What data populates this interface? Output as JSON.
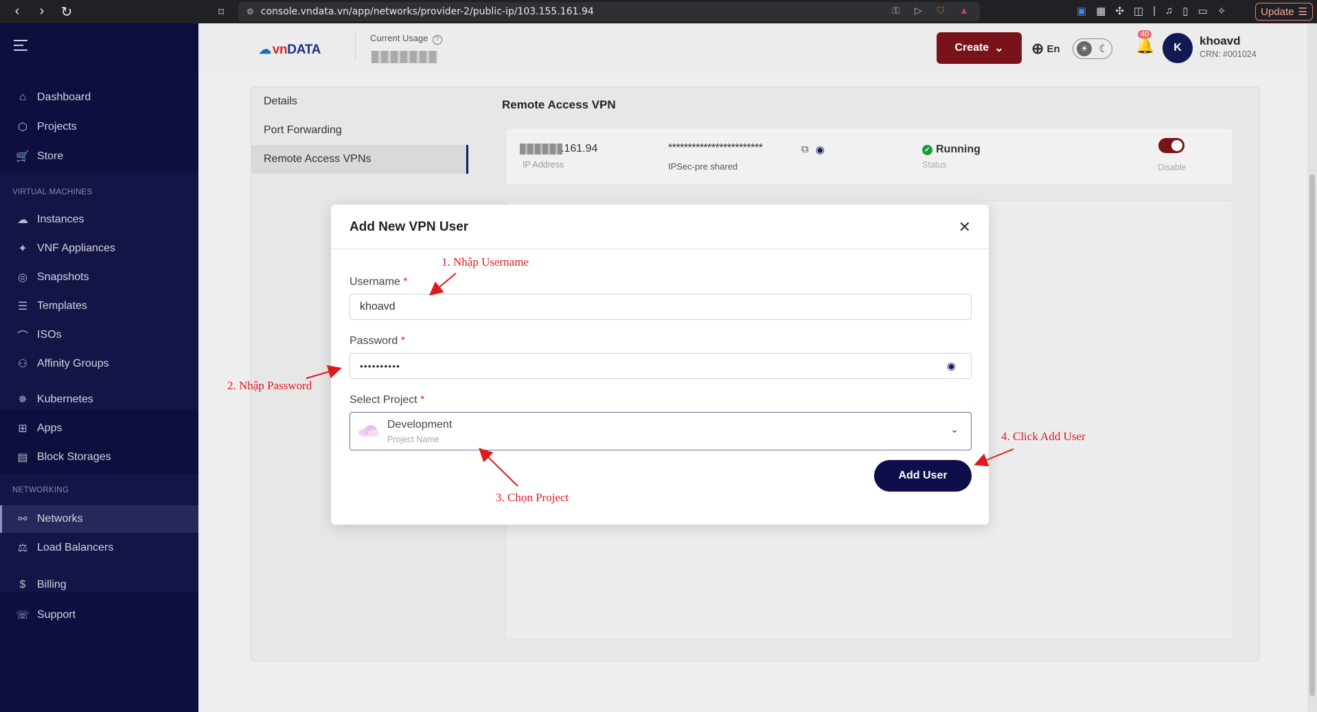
{
  "browser": {
    "url": "console.vndata.vn/app/networks/provider-2/public-ip/103.155.161.94",
    "update_label": "Update",
    "icons": [
      "back-icon",
      "forward-icon",
      "reload-icon",
      "bookmark-icon"
    ]
  },
  "sidebar": {
    "items_top": [
      {
        "label": "Dashboard",
        "icon": "⌂"
      },
      {
        "label": "Projects",
        "icon": "⬡"
      },
      {
        "label": "Store",
        "icon": "🛒"
      }
    ],
    "section_vm": "VIRTUAL MACHINES",
    "items_vm": [
      {
        "label": "Instances",
        "icon": "☁"
      },
      {
        "label": "VNF Appliances",
        "icon": "✦"
      },
      {
        "label": "Snapshots",
        "icon": "◎"
      },
      {
        "label": "Templates",
        "icon": "☰"
      },
      {
        "label": "ISOs",
        "icon": "⌒"
      },
      {
        "label": "Affinity Groups",
        "icon": "⚇"
      }
    ],
    "items_mid": [
      {
        "label": "Kubernetes",
        "icon": "✵"
      },
      {
        "label": "Apps",
        "icon": "⊞"
      },
      {
        "label": "Block Storages",
        "icon": "▤"
      }
    ],
    "section_net": "NETWORKING",
    "items_net": [
      {
        "label": "Networks",
        "icon": "⚯"
      },
      {
        "label": "Load Balancers",
        "icon": "⚖"
      }
    ],
    "items_bottom": [
      {
        "label": "Billing",
        "icon": "$"
      },
      {
        "label": "Support",
        "icon": "☏"
      }
    ]
  },
  "header": {
    "logo_vn": "vn",
    "logo_data": "DATA",
    "current_usage_label": "Current Usage",
    "create_label": "Create",
    "lang": "En",
    "notification_count": "40",
    "avatar_initial": "K",
    "user_name": "khoavd",
    "crn": "CRN: #001024"
  },
  "tabs": [
    "Details",
    "Port Forwarding",
    "Remote Access VPNs"
  ],
  "vpn": {
    "section_title": "Remote Access VPN",
    "ip_value": ".161.94",
    "ip_label": "IP Address",
    "psk_value": "************************",
    "psk_label": "IPSec-pre shared",
    "status_value": "Running",
    "status_label": "Status",
    "toggle_label": "Disable",
    "colors": {
      "accent": "#7a1319",
      "status": "#1c9a3c"
    }
  },
  "modal": {
    "title": "Add New VPN User",
    "username_label": "Username",
    "username_value": "khoavd",
    "password_label": "Password",
    "password_value": "••••••••••",
    "project_label": "Select Project",
    "project_value": "Development",
    "project_sub": "Project Name",
    "required_mark": "*",
    "add_button": "Add User"
  },
  "annotations": {
    "step1": "1. Nhập Username",
    "step2": "2. Nhập Password",
    "step3": "3. Chọn Project",
    "step4": "4. Click Add User"
  }
}
